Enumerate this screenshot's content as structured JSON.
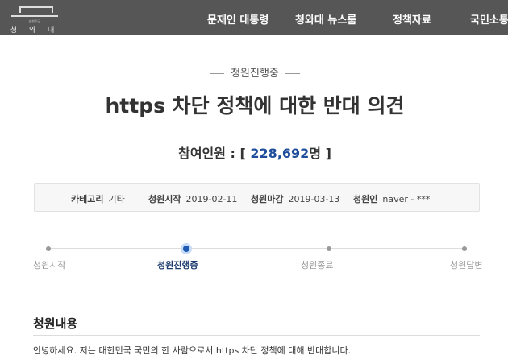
{
  "header": {
    "logo": {
      "small_text": "대한민국",
      "name": "청 와 대"
    },
    "nav": [
      "문재인 대통령",
      "청와대 뉴스룸",
      "정책자료",
      "국민소통"
    ]
  },
  "petition": {
    "status": "청원진행중",
    "title": "https por 차단 정책에 대한 반대 의견",
    "participants_label": "참여인원 : [",
    "participants_value": "228,692",
    "participants_unit": "명 ]",
    "info": {
      "category_label": "카테고리",
      "category": "기타",
      "start_label": "청원시작",
      "start": "2019-02-11",
      "end_label": "청원마감",
      "end": "2019-03-13",
      "author_label": "청원인",
      "author": "naver - ***"
    },
    "timeline": [
      "청원시작",
      "청원진행중",
      "청원종료",
      "청원답변"
    ],
    "timeline_active": 1,
    "content_heading": "청원내용",
    "content": "안녕하세요. 저는 대한민국 국민의 한 사람으로서 https 차단 정책에 대해 반대합니다."
  },
  "colors": {
    "header": "#565656",
    "accent": "#1d4d9b"
  }
}
